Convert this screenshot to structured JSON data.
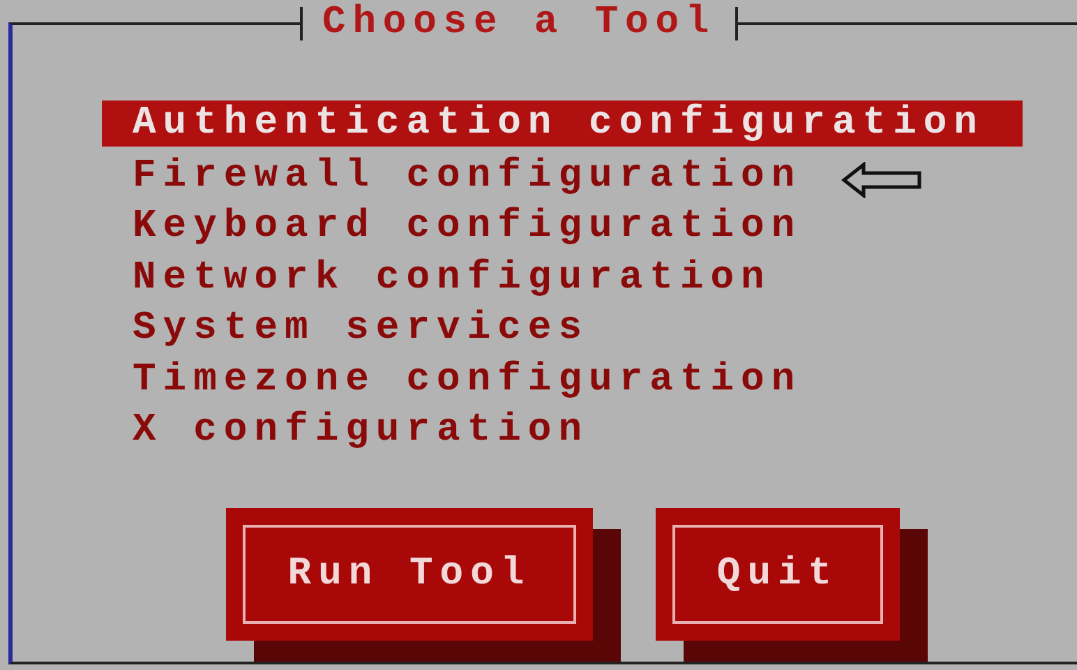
{
  "dialog": {
    "title": "Choose a Tool"
  },
  "tools": [
    {
      "label": "Authentication configuration",
      "selected": true
    },
    {
      "label": "Firewall configuration",
      "selected": false
    },
    {
      "label": "Keyboard configuration",
      "selected": false
    },
    {
      "label": "Network configuration",
      "selected": false
    },
    {
      "label": "System services",
      "selected": false
    },
    {
      "label": "Timezone configuration",
      "selected": false
    },
    {
      "label": "X configuration",
      "selected": false
    }
  ],
  "buttons": [
    "Run Tool",
    "Quit"
  ]
}
